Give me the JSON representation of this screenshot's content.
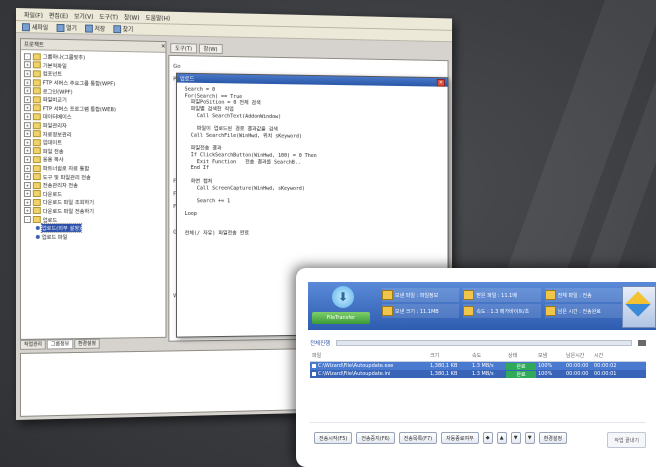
{
  "ide": {
    "menu": [
      "파일(F)",
      "편집(E)",
      "보기(V)",
      "도구(T)",
      "창(W)",
      "도움말(H)"
    ],
    "toolbar": [
      "새파일",
      "열기",
      "저장",
      "찾기"
    ],
    "left_pane_title": "프로젝트",
    "tree": [
      {
        "label": "그룹하나(그룹맞추)",
        "type": "folder",
        "exp": "-"
      },
      {
        "label": "기본적파일",
        "type": "folder",
        "exp": "+"
      },
      {
        "label": "컴포넌트",
        "type": "folder",
        "exp": "+"
      },
      {
        "label": "FTP 서버스 주요그룹 통합(WPF)",
        "type": "folder",
        "exp": "+"
      },
      {
        "label": "로그인(WPF)",
        "type": "folder",
        "exp": "+"
      },
      {
        "label": "파일비교기",
        "type": "folder",
        "exp": "+"
      },
      {
        "label": "FTP 서버스 프로그램 통합(WEB)",
        "type": "folder",
        "exp": "+"
      },
      {
        "label": "데이터베이스",
        "type": "folder",
        "exp": "+"
      },
      {
        "label": "파일관리자",
        "type": "folder",
        "exp": "+"
      },
      {
        "label": "자료정보관리",
        "type": "folder",
        "exp": "+"
      },
      {
        "label": "업데이트",
        "type": "folder",
        "exp": "+"
      },
      {
        "label": "파일 전송",
        "type": "folder",
        "exp": "+"
      },
      {
        "label": "응용 복사",
        "type": "folder",
        "exp": "+"
      },
      {
        "label": "파트너쉽로 자료 통합",
        "type": "folder",
        "exp": "+"
      },
      {
        "label": "도구 및 파일관리 전송",
        "type": "folder",
        "exp": "+"
      },
      {
        "label": "전송관리자 전송",
        "type": "folder",
        "exp": "+"
      },
      {
        "label": "다운로드",
        "type": "folder",
        "exp": "+"
      },
      {
        "label": "다운로드 파일 조회하기",
        "type": "folder",
        "exp": "+"
      },
      {
        "label": "다운로드 파일 전송하기",
        "type": "folder",
        "exp": "+"
      },
      {
        "label": "업로드",
        "type": "folder",
        "exp": "-"
      },
      {
        "label": "업로드(외부 설정)",
        "type": "item",
        "selected": true
      },
      {
        "label": "업로드 파일",
        "type": "item"
      }
    ],
    "left_tabs": [
      "작업관리",
      "그룹정보",
      "환경설정"
    ],
    "doc_tabs": [
      "도구(T)",
      "창(W)"
    ],
    "gutter": [
      "Go",
      "Pol",
      "",
      "",
      "",
      "",
      "",
      "",
      "",
      "F",
      "F",
      "F",
      "",
      "Go",
      "",
      "",
      "",
      "",
      "Wi"
    ],
    "dialog_title": "업로드",
    "code_lines": [
      "Search = 0",
      "For(Search) == True",
      "  파일PoSition = 0 전체 검색",
      "  파일별 검색한 작업",
      "    Call SearchText(AddonWindow)",
      "",
      "    파일이 업로드된 경로 결과값을 검색",
      "  Call SearchFile(WinHwd, 위치 sKeyword)",
      "",
      "  파일전송 결과",
      "  If ClickSearchButton(WinHwd, 100) = 0 Then",
      "    Exit Function   전송 결과를 SearchB..",
      "  End If",
      "",
      "  화면 캡처",
      "    Call ScreenCapture(WinHwd, sKeyword)",
      "",
      "    Search += 1",
      "",
      "Loop",
      "",
      "",
      "전체(/ 자유) 파일전송 완료"
    ]
  },
  "ft": {
    "logo_label": "FileTransfer",
    "info": [
      {
        "label": "보낸 파일 : 파일정보"
      },
      {
        "label": "받은 파일 : 11.1메"
      },
      {
        "label": "전체 파일 : 전송"
      },
      {
        "label": "보낸 크기 : 11.1MB"
      },
      {
        "label": "속도 : 1.3 메가바이트/초"
      },
      {
        "label": "남은 시간 : 전송완료"
      }
    ],
    "progress_label": "전체진행",
    "columns": [
      "파일",
      "크기",
      "속도",
      "상태",
      "보냄",
      "남은시간",
      "시간",
      ""
    ],
    "rows": [
      {
        "name": "C:\\Wizard\\File\\Autoupdate.exe",
        "size": "1,380,1 KB",
        "speed": "1.3 MB/s",
        "status": "완료",
        "sent": "100%",
        "remain": "00:00:00",
        "time": "00:00:02",
        "extra": ""
      },
      {
        "name": "C:\\Wizard\\File\\Autoupdate.ini",
        "size": "1,380,1 KB",
        "speed": "1.3 MB/s",
        "status": "완료",
        "sent": "100%",
        "remain": "00:00:00",
        "time": "00:00:01",
        "extra": ""
      }
    ],
    "buttons": [
      "전송시작(F5)",
      "전송중지(F6)",
      "전송목록(F7)",
      "자동종료여부",
      "◆",
      "▲",
      "▼",
      "▼"
    ],
    "settings_button": "환경설정",
    "close_button": "작업 끝내기"
  }
}
